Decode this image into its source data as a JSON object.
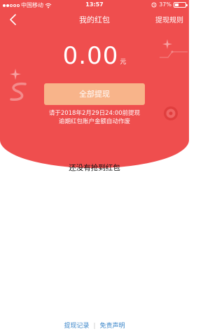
{
  "status_bar": {
    "carrier": "中国移动",
    "time": "13:57",
    "battery": "37%",
    "signal_dots_filled": 2,
    "signal_dots_total": 5
  },
  "navbar": {
    "title": "我的红包",
    "rules_label": "提现规则",
    "back_icon": "chevron-left-icon"
  },
  "balance": {
    "value": "0.00",
    "unit": "元"
  },
  "withdraw_button": {
    "label": "全部提现"
  },
  "notice": {
    "line1": "请于2018年2月29日24:00前提现",
    "line2": "逾期红包账户金额自动作废"
  },
  "empty_state": {
    "text": "还没有抢到红包"
  },
  "footer": {
    "records_link": "提现记录",
    "separator": "|",
    "disclaimer_link": "免责声明"
  },
  "colors": {
    "header_red": "#ef4e4e",
    "button_peach": "#f8b48a",
    "link_blue": "#3b86c9"
  }
}
